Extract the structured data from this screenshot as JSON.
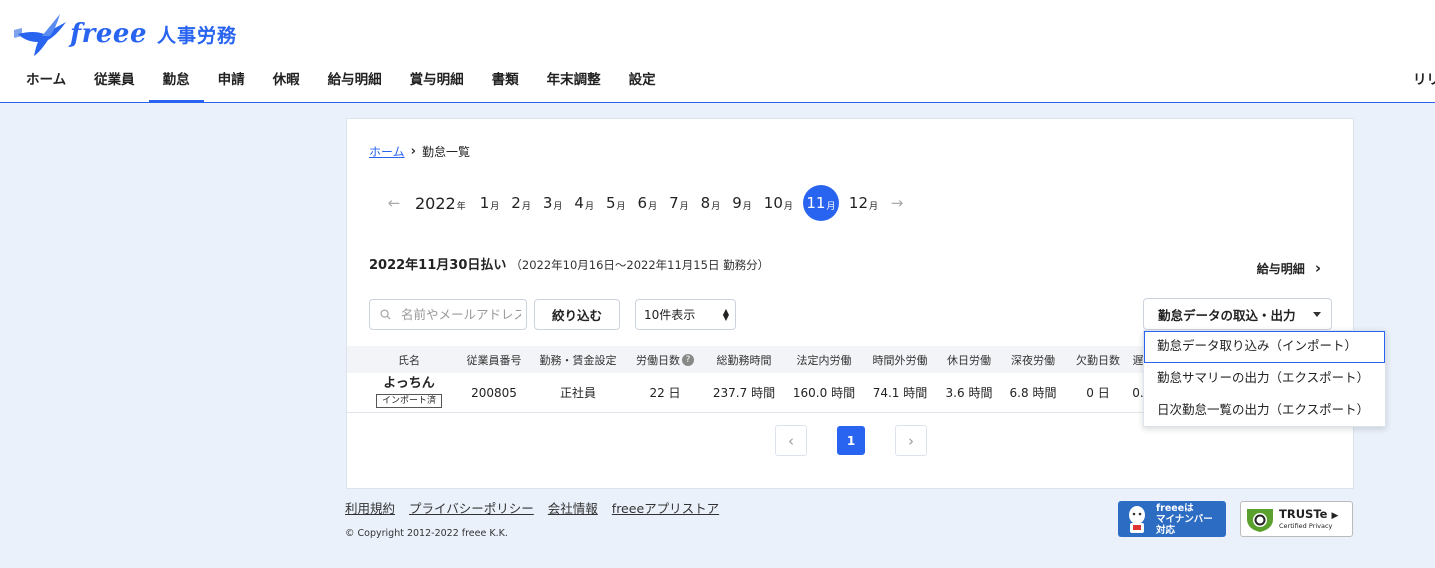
{
  "header": {
    "logo_text": "freee",
    "logo_sub": "人事労務",
    "nav": [
      {
        "label": "ホーム"
      },
      {
        "label": "従業員"
      },
      {
        "label": "勤怠"
      },
      {
        "label": "申請"
      },
      {
        "label": "休暇"
      },
      {
        "label": "給与明細"
      },
      {
        "label": "賞与明細"
      },
      {
        "label": "書類"
      },
      {
        "label": "年末調整"
      },
      {
        "label": "設定"
      }
    ],
    "active_nav": "勤怠",
    "right_cut_text": "リリ"
  },
  "breadcrumb": {
    "home": "ホーム",
    "current": "勤怠一覧"
  },
  "month_selector": {
    "year": "2022",
    "year_unit": "年",
    "month_unit": "月",
    "months": [
      "1",
      "2",
      "3",
      "4",
      "5",
      "6",
      "7",
      "8",
      "9",
      "10",
      "11",
      "12"
    ],
    "selected": "11"
  },
  "pay_period": {
    "title": "2022年11月30日払い",
    "range": "（2022年10月16日～2022年11月15日 勤務分）"
  },
  "payslip_link": "給与明細",
  "filters": {
    "search_placeholder": "名前やメールアドレス",
    "filter_button": "絞り込む",
    "per_page": "10件表示"
  },
  "table": {
    "headers": [
      "氏名",
      "従業員番号",
      "勤務・賃金設定",
      "労働日数",
      "総勤務時間",
      "法定内労働",
      "時間外労働",
      "休日労働",
      "深夜労働",
      "欠勤日数",
      "遅"
    ],
    "rows": [
      {
        "name": "よっちん",
        "badge": "インポート済",
        "employee_no": "200805",
        "setting": "正社員",
        "work_days": "22 日",
        "total_hours": "237.7 時間",
        "legal_hours": "160.0 時間",
        "overtime": "74.1 時間",
        "holiday": "3.6 時間",
        "night": "6.8 時間",
        "absence": "0 日",
        "late": "0."
      }
    ]
  },
  "pagination": {
    "current": "1"
  },
  "export_dropdown": {
    "label": "勤怠データの取込・出力",
    "items": [
      "勤怠データ取り込み（インポート）",
      "勤怠サマリーの出力（エクスポート）",
      "日次勤怠一覧の出力（エクスポート）"
    ]
  },
  "footer": {
    "links": [
      "利用規約",
      "プライバシーポリシー",
      "会社情報",
      "freeeアプリストア"
    ],
    "copyright": "© Copyright 2012-2022 freee K.K.",
    "mynumber_badge": [
      "freeeは",
      "マイナンバー",
      "対応"
    ],
    "truste_title": "TRUSTe",
    "truste_sub": "Certified Privacy"
  },
  "colors": {
    "brand": "#2864f0",
    "background": "#eaf1fb"
  }
}
